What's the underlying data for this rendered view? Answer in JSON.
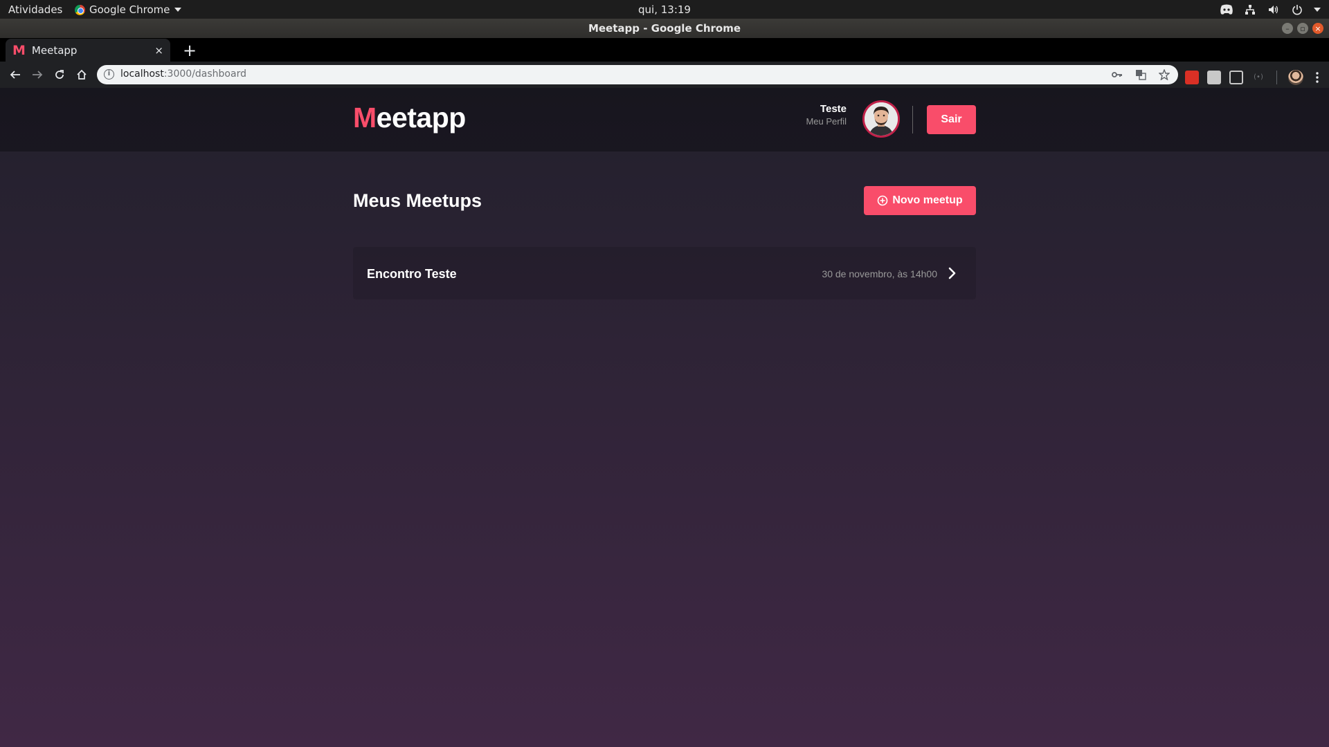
{
  "os": {
    "activities_label": "Atividades",
    "app_menu_label": "Google Chrome",
    "clock": "qui, 13:19"
  },
  "window": {
    "title": "Meetapp - Google Chrome"
  },
  "browser": {
    "tab": {
      "favicon": "M",
      "title": "Meetapp",
      "close": "×"
    },
    "new_tab": "+",
    "address": {
      "host": "localhost",
      "path": ":3000/dashboard"
    }
  },
  "header": {
    "logo_initial": "M",
    "logo_rest": "eetapp",
    "profile_name": "Teste",
    "profile_link": "Meu Perfil",
    "logout_label": "Sair"
  },
  "main": {
    "title": "Meus Meetups",
    "new_button_label": "Novo meetup",
    "meetups": [
      {
        "title": "Encontro Teste",
        "date": "30 de novembro, às 14h00"
      }
    ]
  },
  "colors": {
    "accent": "#f94d6a",
    "background_top": "#22202c",
    "background_bottom": "#402845"
  },
  "icons": {
    "new_meetup": "add-circle-icon",
    "meetup_arrow": "chevron-right-icon"
  }
}
